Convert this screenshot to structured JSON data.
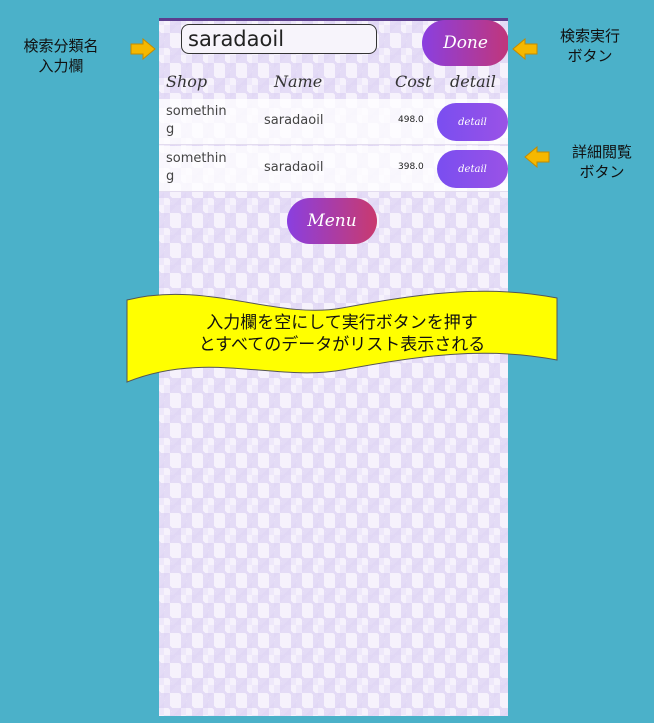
{
  "search": {
    "value": "saradaoil",
    "done_label": "Done"
  },
  "table": {
    "headers": [
      "Shop",
      "Name",
      "Cost",
      "detail"
    ],
    "rows": [
      {
        "shop": "something",
        "name": "saradaoil",
        "cost": "498.0",
        "detail_label": "detail"
      },
      {
        "shop": "something",
        "name": "saradaoil",
        "cost": "398.0",
        "detail_label": "detail"
      }
    ]
  },
  "menu_label": "Menu",
  "annotations": {
    "search_input": "検索分類名\n入力欄",
    "done_button": "検索実行\nボタン",
    "detail_button": "詳細閲覧\nボタン",
    "banner_line1": "入力欄を空にして実行ボタンを押す",
    "banner_line2": "とすべてのデータがリスト表示される"
  },
  "colors": {
    "background": "#4bb1c9",
    "arrow": "#f5b800",
    "banner": "#ffff00",
    "button_gradient_start": "#8a3fe0",
    "button_gradient_end": "#c1367a"
  }
}
